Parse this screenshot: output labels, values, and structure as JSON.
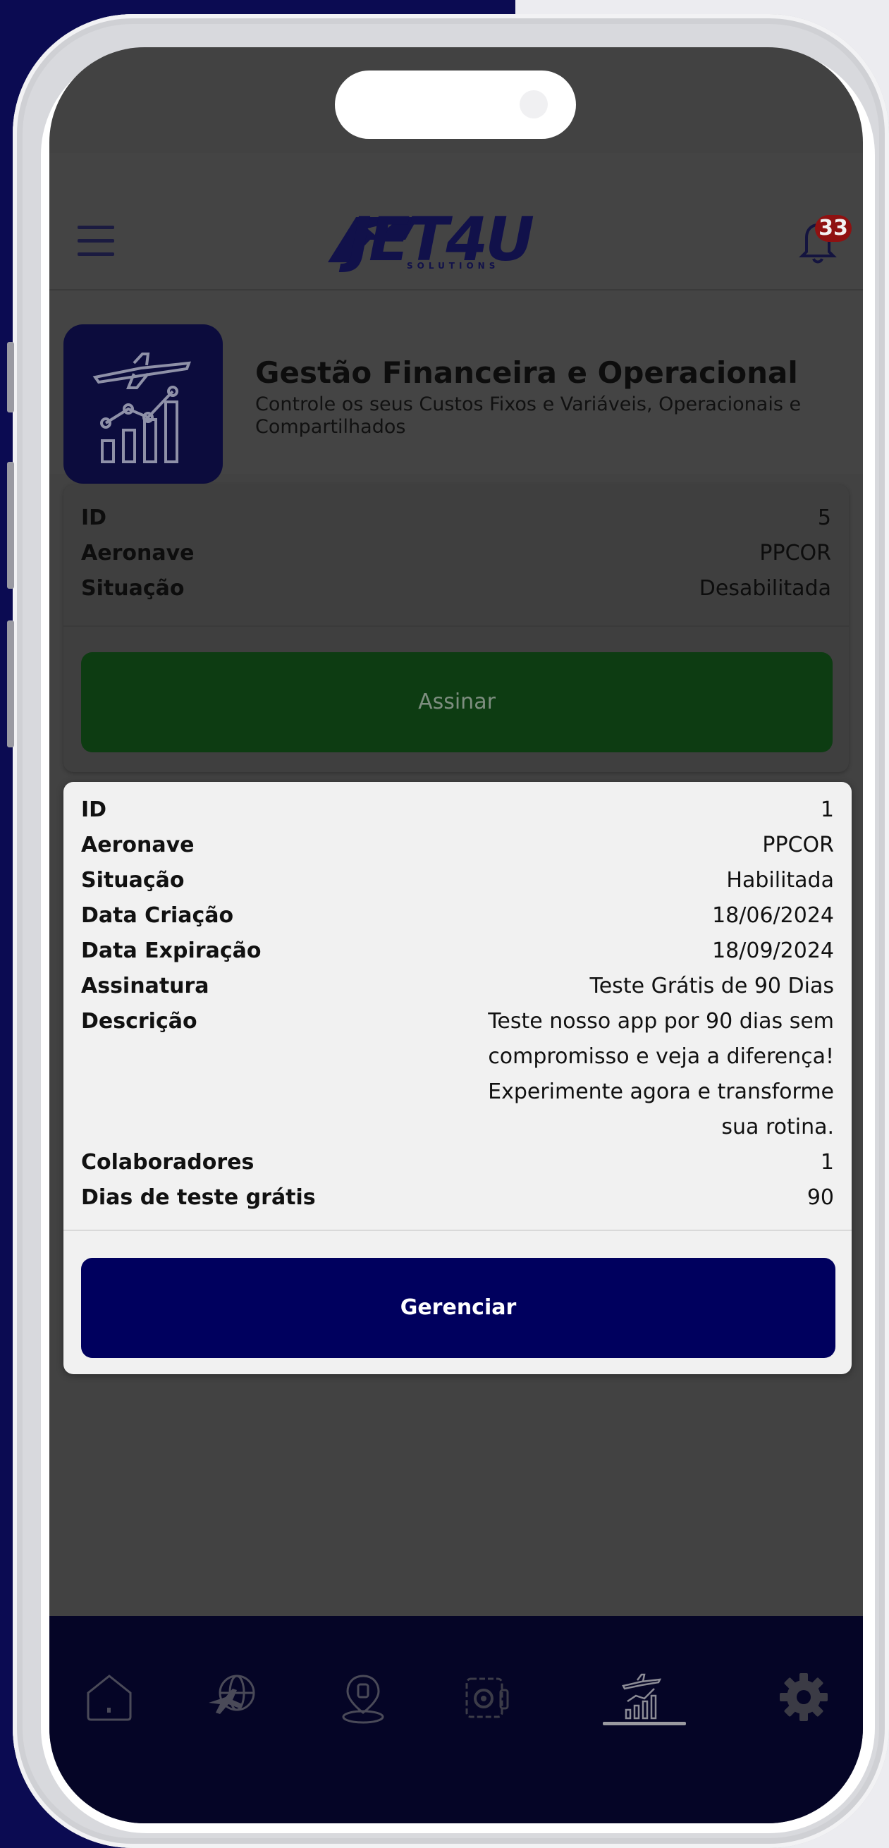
{
  "header": {
    "logo_text": "JET4U",
    "logo_sub": "SOLUTIONS",
    "notification_count": "33"
  },
  "module": {
    "title": "Gestão Financeira e Operacional",
    "subtitle": "Controle os seus Custos Fixos e Variáveis, Operacionais e Compartilhados"
  },
  "card1": {
    "rows": [
      {
        "label": "ID",
        "value": "5"
      },
      {
        "label": "Aeronave",
        "value": "PPCOR"
      },
      {
        "label": "Situação",
        "value": "Desabilitada"
      }
    ],
    "button_label": "Assinar"
  },
  "card2": {
    "rows": [
      {
        "label": "ID",
        "value": "1"
      },
      {
        "label": "Aeronave",
        "value": "PPCOR"
      },
      {
        "label": "Situação",
        "value": "Habilitada"
      },
      {
        "label": "Data Criação",
        "value": "18/06/2024"
      },
      {
        "label": "Data Expiração",
        "value": "18/09/2024"
      },
      {
        "label": "Assinatura",
        "value": "Teste Grátis de 90 Dias"
      }
    ],
    "descricao_label": "Descrição",
    "descricao_lines": [
      "Teste nosso app por 90 dias sem",
      "compromisso e veja a diferença!",
      "Experimente agora e transforme",
      "sua rotina."
    ],
    "rows_after": [
      {
        "label": "Colaboradores",
        "value": "1"
      },
      {
        "label": "Dias de teste grátis",
        "value": "90"
      }
    ],
    "button_label": "Gerenciar"
  },
  "navbar": {
    "items": [
      "home-icon",
      "flight-globe-icon",
      "location-pin-icon",
      "settings-document-icon",
      "financial-chart-icon",
      "gear-icon"
    ],
    "active": "financial-chart-icon"
  },
  "colors": {
    "brand_navy": "#00005e",
    "assinar_green": "#0d3c12",
    "badge_red": "#8f1111"
  }
}
